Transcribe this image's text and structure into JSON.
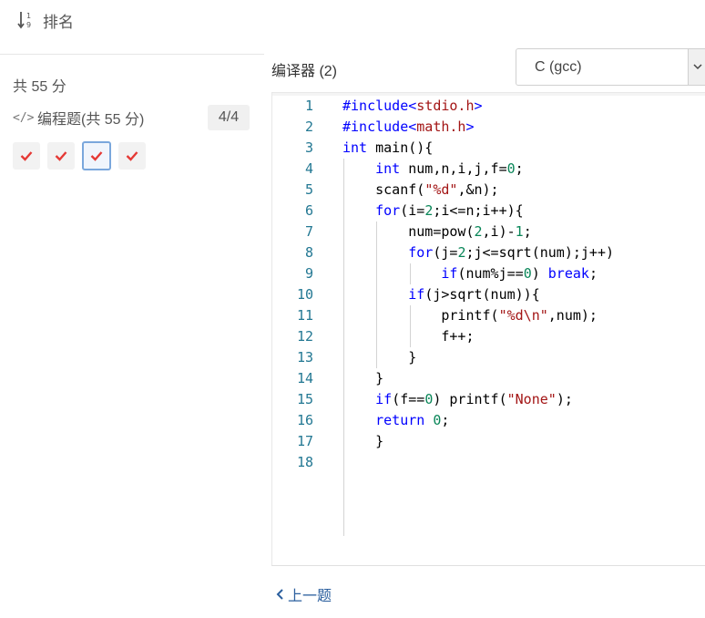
{
  "header": {
    "rank_label": "排名"
  },
  "sidebar": {
    "total_score": "共 55 分",
    "section": {
      "title": "编程题(共 55 分)",
      "count": "4/4"
    },
    "questions": [
      {
        "status": "answered",
        "active": false
      },
      {
        "status": "answered",
        "active": false
      },
      {
        "status": "answered",
        "active": true
      },
      {
        "status": "answered",
        "active": false
      }
    ]
  },
  "editor": {
    "label": "编译器 (2)",
    "language": "C (gcc)",
    "line_numbers": [
      "1",
      "2",
      "3",
      "4",
      "5",
      "6",
      "7",
      "8",
      "9",
      "10",
      "11",
      "12",
      "13",
      "14",
      "15",
      "16",
      "17",
      "18"
    ],
    "code_lines": [
      "#include<stdio.h>",
      "#include<math.h>",
      "int main(){",
      "    int num,n,i,j,f=0;",
      "    scanf(\"%d\",&n);",
      "    for(i=2;i<=n;i++){",
      "        num=pow(2,i)-1;",
      "        for(j=2;j<=sqrt(num);j++)",
      "            if(num%j==0) break;",
      "        if(j>sqrt(num)){",
      "            printf(\"%d\\n\",num);",
      "            f++;",
      "        }",
      "    }",
      "    if(f==0) printf(\"None\");",
      "    return 0;",
      "    }",
      ""
    ]
  },
  "footer": {
    "prev_label": "上一题"
  },
  "colors": {
    "accent": "#2b5f9e",
    "check": "#e53935",
    "keyword": "#0000ff",
    "string": "#a31515",
    "number": "#098658",
    "line_number": "#237893"
  }
}
